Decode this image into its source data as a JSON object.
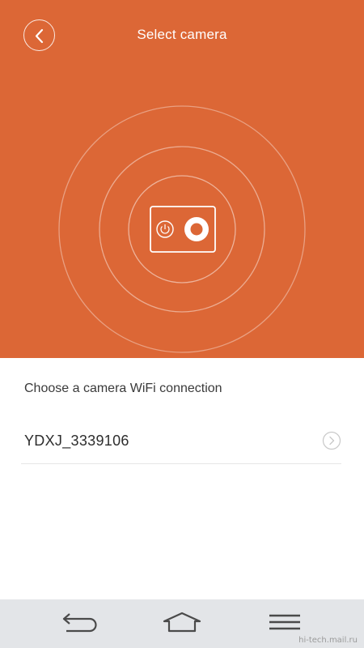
{
  "header": {
    "title": "Select camera",
    "back_icon": "chevron-left-icon",
    "background_color": "#dc6736"
  },
  "illustration": {
    "icons": [
      "camera-icon",
      "power-icon",
      "shutter-icon"
    ]
  },
  "wifi_section": {
    "label": "Choose a camera WiFi connection",
    "networks": [
      {
        "name": "YDXJ_3339106",
        "icon": "chevron-right-icon"
      }
    ]
  },
  "navbar": {
    "buttons": [
      {
        "icon": "back-arrow-icon"
      },
      {
        "icon": "home-icon"
      },
      {
        "icon": "menu-icon"
      }
    ],
    "background_color": "#e3e5e8"
  },
  "watermark": "hi-tech.mail.ru"
}
